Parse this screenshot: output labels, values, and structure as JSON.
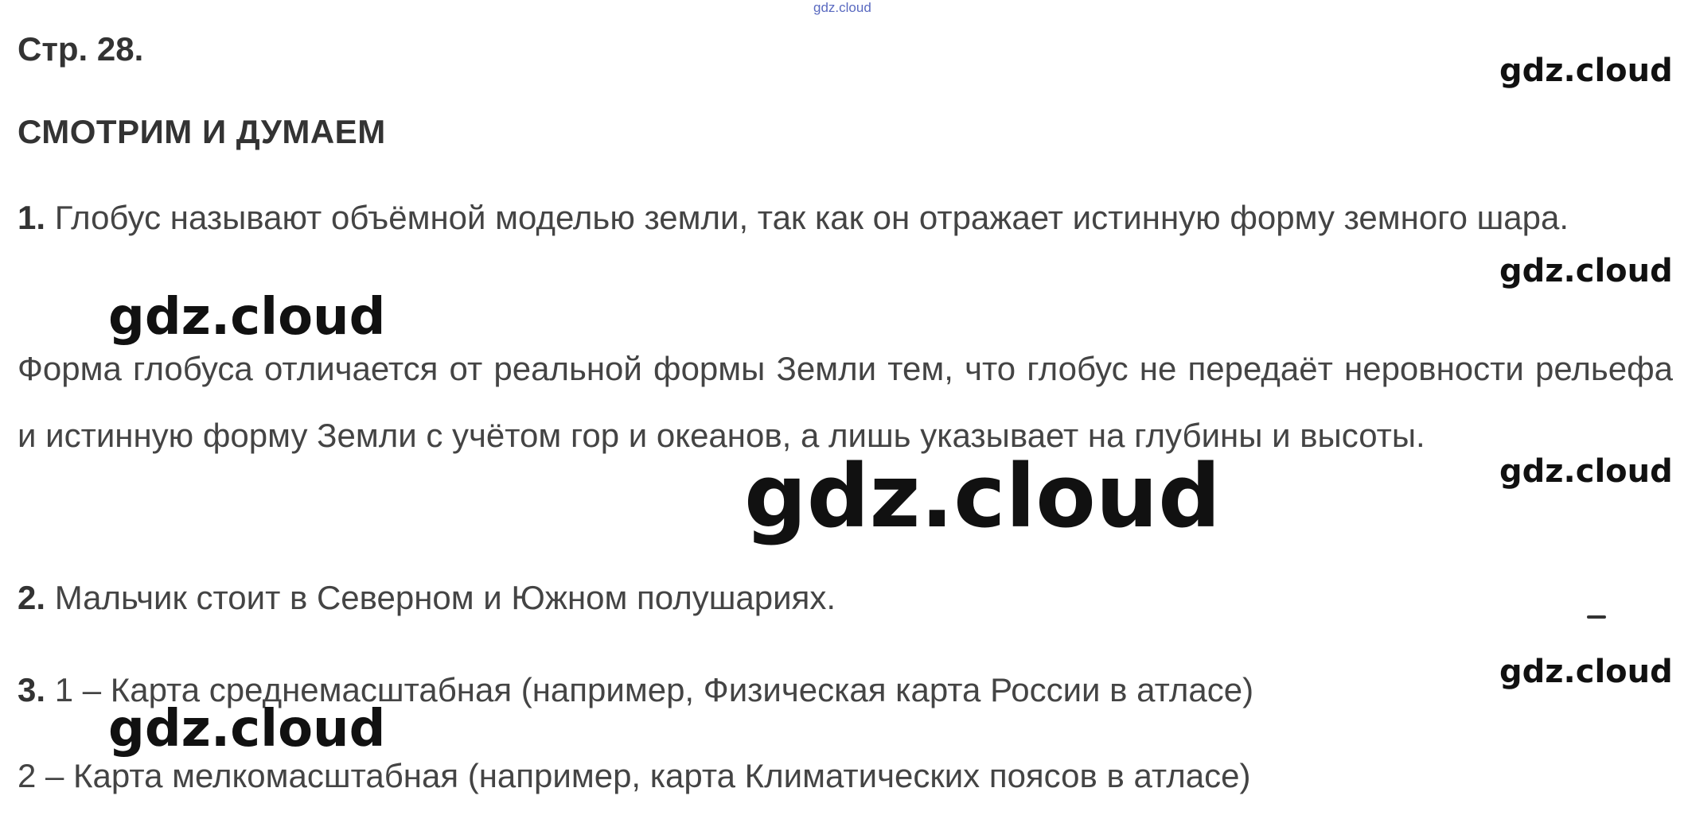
{
  "watermarks": {
    "top": "gdz.cloud",
    "right": [
      "gdz.cloud",
      "gdz.cloud",
      "gdz.cloud",
      "gdz.cloud"
    ],
    "left": [
      "gdz.cloud",
      "gdz.cloud"
    ],
    "center": "gdz.cloud"
  },
  "page_number": "Стр. 28.",
  "section_title": "СМОТРИМ И ДУМАЕМ",
  "answers": [
    {
      "num": "1.",
      "text": "Глобус называют объёмной моделью земли, так как он отражает истинную форму земного шара."
    },
    {
      "text": "Форма глобуса отличается от реальной формы Земли тем, что глобус не передаёт неровности рельефа и истинную форму Земли с учётом гор и океанов, а лишь указывает на глубины и высоты."
    },
    {
      "num": "2.",
      "text": "Мальчик стоит в Северном и Южном полушариях."
    },
    {
      "num": "3.",
      "text": "1 – Карта среднемасштабная (например, Физическая карта России в атласе)"
    },
    {
      "text": "2 – Карта мелкомасштабная (например, карта Климатических поясов в атласе)"
    }
  ]
}
